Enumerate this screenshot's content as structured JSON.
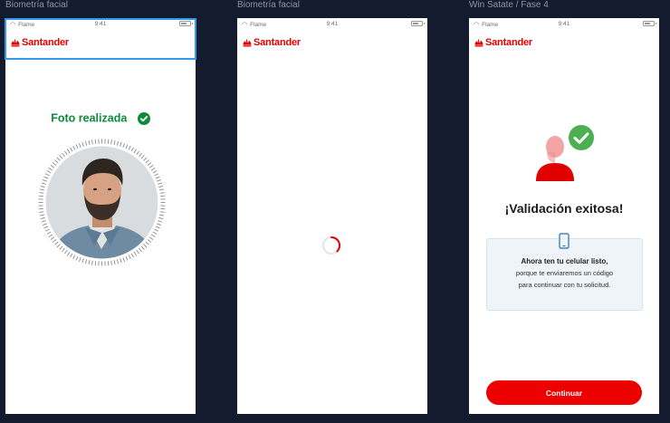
{
  "frames": [
    {
      "title": "Biometría facial"
    },
    {
      "title": "Biometría facial"
    },
    {
      "title": "Win Satate / Fase 4"
    }
  ],
  "status_bar": {
    "carrier": "Flame",
    "time": "9:41"
  },
  "brand": {
    "name": "Santander",
    "color": "#e60000"
  },
  "screen1": {
    "success_text": "Foto realizada",
    "success_color": "#0f8a3a"
  },
  "screen2": {
    "state": "loading"
  },
  "screen3": {
    "title": "¡Validación exitosa!",
    "card_line1": "Ahora ten tu celular listo,",
    "card_line2": "porque te enviaremos un código",
    "card_line3": "para continuar con tu solicitud.",
    "button_label": "Continuar",
    "button_color": "#ec0000"
  },
  "selection_color": "#2f9bf0"
}
